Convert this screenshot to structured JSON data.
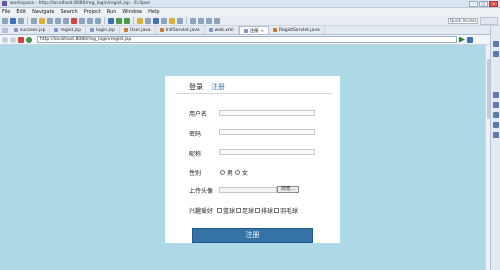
{
  "window": {
    "title": "workspace - http://localhost:8080/reg_login/regist.jsp - Eclipse"
  },
  "menu": [
    "File",
    "Edit",
    "Navigate",
    "Search",
    "Project",
    "Run",
    "Window",
    "Help"
  ],
  "toolbar": {
    "quick_access_placeholder": "Quick Access"
  },
  "tabs": [
    {
      "label": "success.jsp",
      "type": "jsp"
    },
    {
      "label": "regist.jsp",
      "type": "jsp"
    },
    {
      "label": "login.jsp",
      "type": "jsp"
    },
    {
      "label": "User.java",
      "type": "java"
    },
    {
      "label": "InitServlet.java",
      "type": "java"
    },
    {
      "label": "web.xml",
      "type": "xml"
    },
    {
      "label": "注册",
      "type": "browser",
      "active": true
    },
    {
      "label": "RegistServlet.java",
      "type": "java"
    }
  ],
  "browser": {
    "url": "http://localhost:8080/reg_login/regist.jsp"
  },
  "form": {
    "tab_login": "登录",
    "tab_register": "注册",
    "username_label": "用户名",
    "password_label": "密码",
    "nickname_label": "昵称",
    "gender_label": "性别",
    "gender_male": "男",
    "gender_female": "女",
    "avatar_label": "上传头像",
    "browse_label": "浏览...",
    "hobby_label": "兴趣爱好",
    "hobbies": [
      "篮球",
      "足球",
      "排球",
      "羽毛球"
    ],
    "submit_label": "注册"
  },
  "colors": {
    "viewport_bg": "#add8e6",
    "button_bg": "#3572a5",
    "register_tab": "#3a7bbf"
  }
}
